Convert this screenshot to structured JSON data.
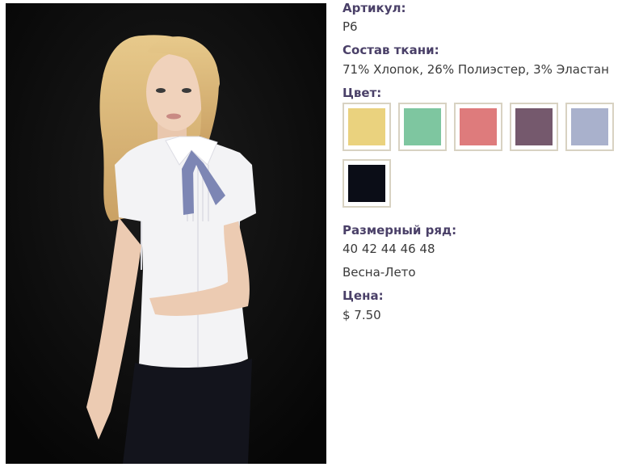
{
  "photo": {
    "alt_name": "model-photo"
  },
  "product": {
    "article_label": "Артикул:",
    "article_value": "P6",
    "fabric_label": "Состав ткани:",
    "fabric_value": "71% Хлопок, 26% Полиэстер, 3% Эластан",
    "color_label": "Цвет:",
    "colors": [
      {
        "name": "yellow",
        "hex": "#ead27e"
      },
      {
        "name": "mint",
        "hex": "#7ec6a0"
      },
      {
        "name": "coral",
        "hex": "#de7b7c"
      },
      {
        "name": "plum",
        "hex": "#75596d"
      },
      {
        "name": "light-blue-gray",
        "hex": "#a9b1cc"
      },
      {
        "name": "black",
        "hex": "#0b0d17"
      }
    ],
    "sizes_label": "Размерный ряд:",
    "sizes_value": "40 42 44 46 48",
    "season_value": "Весна-Лето",
    "price_label": "Цена:",
    "price_value": "$ 7.50"
  }
}
